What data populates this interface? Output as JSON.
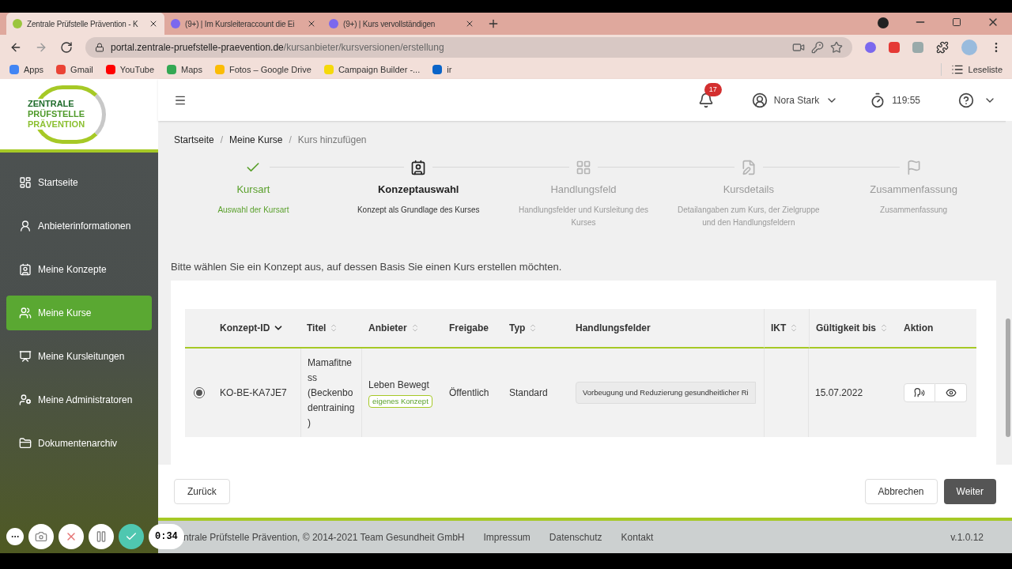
{
  "browser": {
    "tabs": [
      {
        "title": "Zentrale Prüfstelle Prävention - K",
        "selected": true
      },
      {
        "title": "(9+) | Im Kursleiteraccount die Ei",
        "selected": false
      },
      {
        "title": "(9+) | Kurs vervollständigen",
        "selected": false
      }
    ],
    "url_host": "portal.zentrale-pruefstelle-praevention.de",
    "url_path": "/kursanbieter/kursversionen/erstellung",
    "bookmarks": [
      "Apps",
      "Gmail",
      "YouTube",
      "Maps",
      "Fotos – Google Drive",
      "Campaign Builder -...",
      "ir"
    ],
    "reading_list": "Leseliste"
  },
  "sidebar": {
    "logo": [
      "ZENTRALE",
      "PRÜFSTELLE",
      "PRÄVENTION"
    ],
    "items": [
      {
        "label": "Startseite",
        "selected": false
      },
      {
        "label": "Anbieterinformationen",
        "selected": false
      },
      {
        "label": "Meine Konzepte",
        "selected": false
      },
      {
        "label": "Meine Kurse",
        "selected": true
      },
      {
        "label": "Meine Kursleitungen",
        "selected": false
      },
      {
        "label": "Meine Administratoren",
        "selected": false
      },
      {
        "label": "Dokumentenarchiv",
        "selected": false
      }
    ]
  },
  "header": {
    "notification_count": "17",
    "user": "Nora Stark",
    "timer": "119:55"
  },
  "breadcrumbs": {
    "separator": "/",
    "items": [
      {
        "label": "Startseite",
        "link": true
      },
      {
        "label": "Meine Kurse",
        "link": true
      },
      {
        "label": "Kurs hinzufügen",
        "link": false
      }
    ]
  },
  "steps": [
    {
      "title": "Kursart",
      "subtitle": "Auswahl der Kursart",
      "done": true,
      "selected": false
    },
    {
      "title": "Konzeptauswahl",
      "subtitle": "Konzept als Grundlage des Kurses",
      "done": false,
      "selected": true
    },
    {
      "title": "Handlungsfeld",
      "subtitle": "Handlungsfelder und Kursleitung des Kurses",
      "done": false,
      "selected": false
    },
    {
      "title": "Kursdetails",
      "subtitle": "Detailangaben zum Kurs, der Zielgruppe und den Handlungsfeldern",
      "done": false,
      "selected": false
    },
    {
      "title": "Zusammenfassung",
      "subtitle": "Zusammenfassung",
      "done": false,
      "selected": false
    }
  ],
  "prompt": "Bitte wählen Sie ein Konzept aus, auf dessen Basis Sie einen Kurs erstellen möchten.",
  "table": {
    "columns": [
      {
        "label": "Konzept-ID",
        "sortable": true,
        "sorted": true
      },
      {
        "label": "Titel",
        "sortable": true,
        "sorted": false
      },
      {
        "label": "Anbieter",
        "sortable": true,
        "sorted": false
      },
      {
        "label": "Freigabe",
        "sortable": false,
        "sorted": false
      },
      {
        "label": "Typ",
        "sortable": true,
        "sorted": false
      },
      {
        "label": "Handlungsfelder",
        "sortable": false,
        "sorted": false
      },
      {
        "label": "IKT",
        "sortable": true,
        "sorted": false
      },
      {
        "label": "Gültigkeit bis",
        "sortable": true,
        "sorted": false
      },
      {
        "label": "Aktion",
        "sortable": false,
        "sorted": false
      }
    ],
    "rows": [
      {
        "selected": true,
        "id": "KO-BE-KA7JE7",
        "title": "Mamafitness (Beckenbodentraining)",
        "provider": "Leben Bewegt",
        "provider_badge": "eigenes Konzept",
        "release": "Öffentlich",
        "type": "Standard",
        "fields": "Vorbeugung und Reduzierung gesundheitlicher Ri",
        "valid_until": "15.07.2022"
      }
    ]
  },
  "actions": {
    "back": "Zurück",
    "cancel": "Abbrechen",
    "next": "Weiter"
  },
  "footer": {
    "copyright": "ntrale Prüfstelle Prävention, © 2014-2021 Team Gesundheit GmbH",
    "links": [
      "Impressum",
      "Datenschutz",
      "Kontakt"
    ],
    "version": "v.1.0.12"
  },
  "recorder": {
    "time": "0:34"
  }
}
